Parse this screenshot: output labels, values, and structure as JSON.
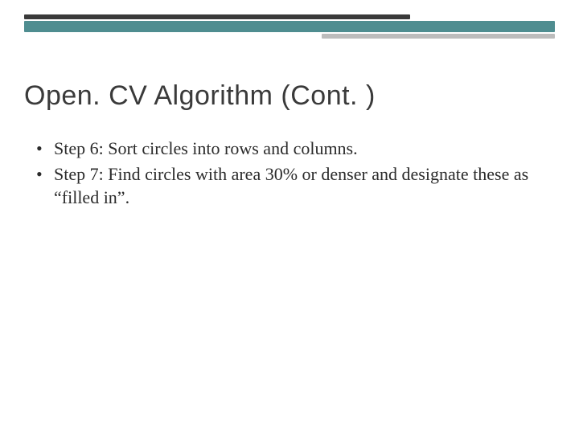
{
  "title": "Open. CV Algorithm (Cont. )",
  "bullets": [
    "Step 6: Sort circles into rows and columns.",
    "Step 7: Find circles with area 30% or denser and designate these as “filled in”."
  ]
}
